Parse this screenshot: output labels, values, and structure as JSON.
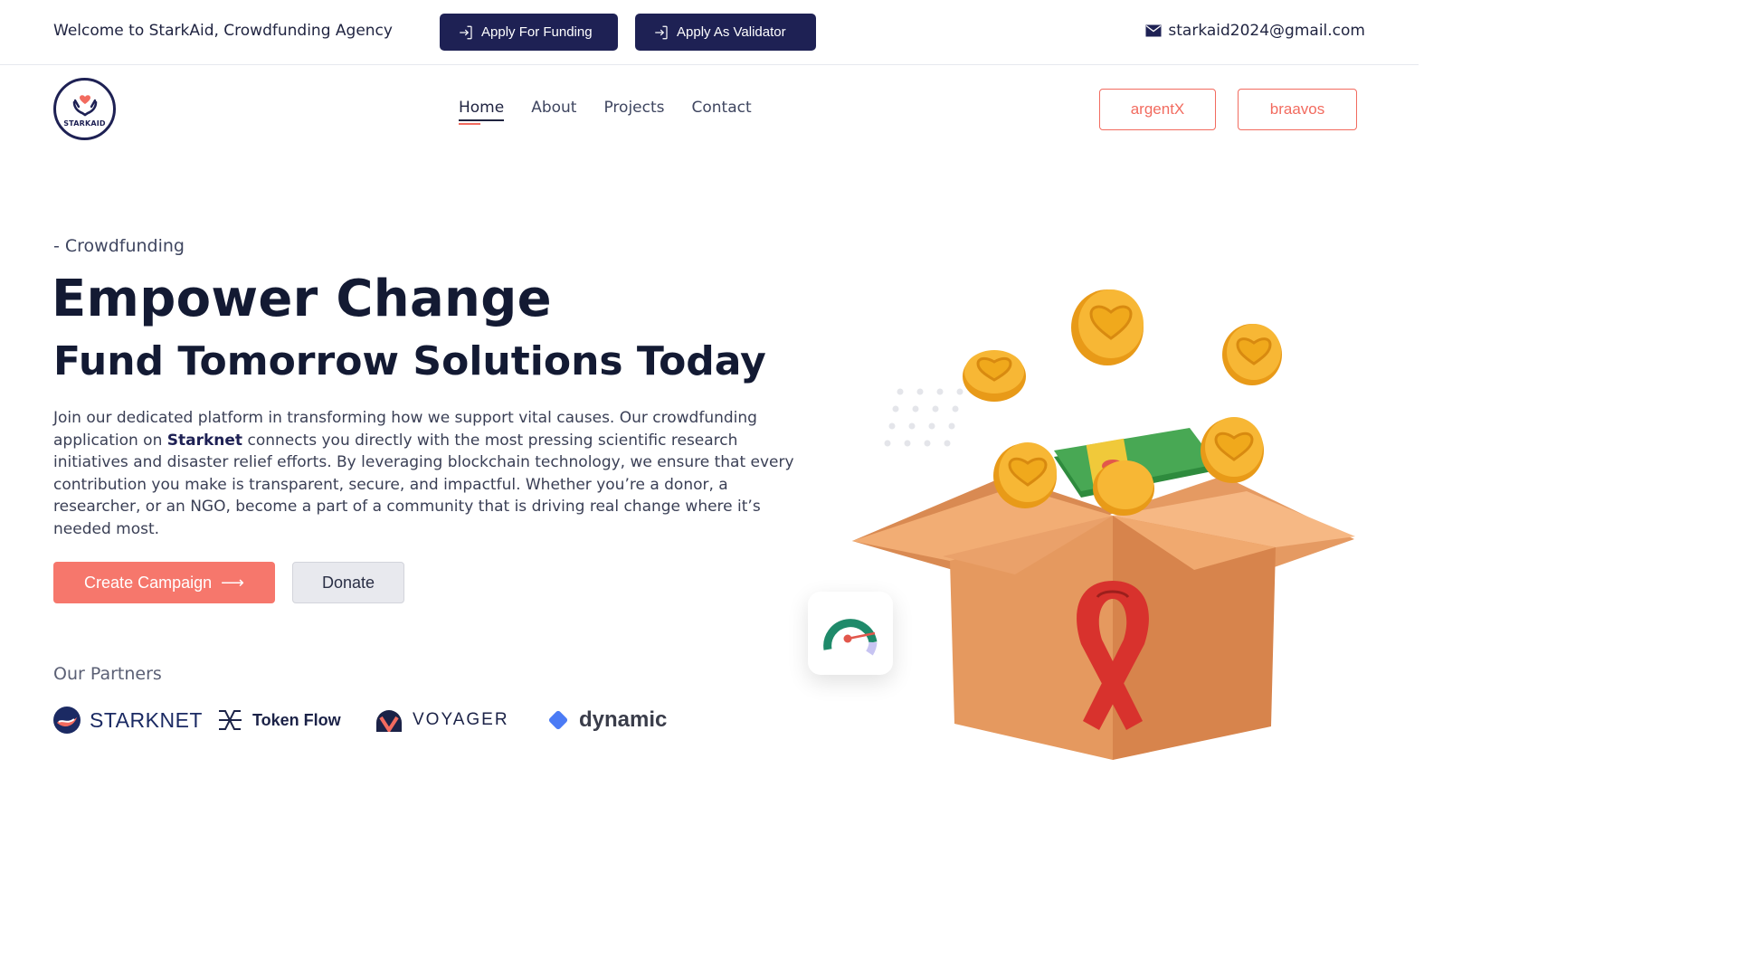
{
  "topbar": {
    "welcome": "Welcome to StarkAid, Crowdfunding Agency",
    "apply_funding": "Apply For Funding",
    "apply_validator": "Apply As Validator",
    "email": "starkaid2024@gmail.com"
  },
  "nav": {
    "logo_text": "STARKAID",
    "items": [
      {
        "label": "Home",
        "active": true
      },
      {
        "label": "About",
        "active": false
      },
      {
        "label": "Projects",
        "active": false
      },
      {
        "label": "Contact",
        "active": false
      }
    ],
    "wallets": [
      "argentX",
      "braavos"
    ]
  },
  "hero": {
    "eyebrow": "- Crowdfunding",
    "title": "Empower Change",
    "subtitle": "Fund Tomorrow Solutions Today",
    "desc_before": "Join our dedicated platform in transforming how we support vital causes. Our crowdfunding application on ",
    "desc_bold": "Starknet",
    "desc_after": " connects you directly with the most pressing scientific research initiatives and disaster relief efforts. By leveraging blockchain technology, we ensure that every contribution you make is transparent, secure, and impactful. Whether you’re a donor, a researcher, or an NGO, become a part of a community that is driving real change where it’s needed most.",
    "create_label": "Create Campaign",
    "create_arrow": "⟶",
    "donate_label": "Donate"
  },
  "partners": {
    "title": "Our Partners",
    "items": [
      {
        "name": "STARKNET",
        "icon": "starknet-logo"
      },
      {
        "name": "Token Flow",
        "icon": "tokenflow-logo"
      },
      {
        "name": "VOYAGER",
        "icon": "voyager-logo"
      },
      {
        "name": "dynamic",
        "icon": "dynamic-logo"
      }
    ]
  },
  "colors": {
    "navy": "#1e2154",
    "coral": "#f6776c",
    "text": "#131a33"
  }
}
